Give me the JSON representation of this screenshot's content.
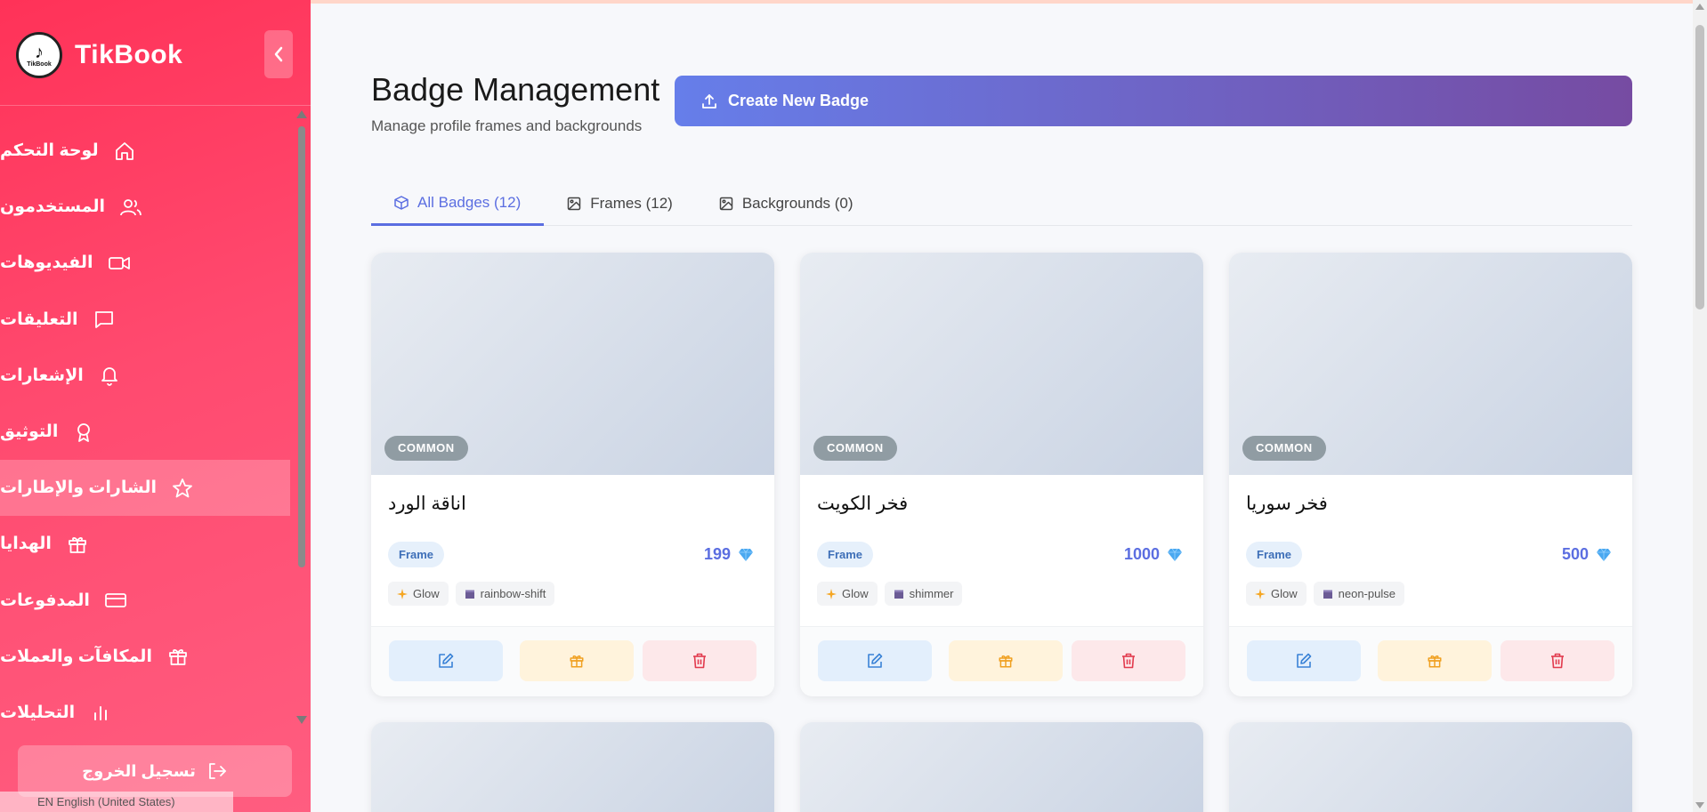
{
  "app": {
    "brand": "TikBook",
    "logo_text": "TikBook"
  },
  "sidebar": {
    "items": [
      {
        "label": "لوحة التحكم",
        "icon": "home-icon"
      },
      {
        "label": "المستخدمون",
        "icon": "users-icon"
      },
      {
        "label": "الفيديوهات",
        "icon": "video-icon"
      },
      {
        "label": "التعليقات",
        "icon": "comment-icon"
      },
      {
        "label": "الإشعارات",
        "icon": "bell-icon"
      },
      {
        "label": "التوثيق",
        "icon": "award-icon"
      },
      {
        "label": "الشارات والإطارات",
        "icon": "star-icon",
        "active": true
      },
      {
        "label": "الهدايا",
        "icon": "gift-icon"
      },
      {
        "label": "المدفوعات",
        "icon": "card-icon"
      },
      {
        "label": "المكافآت والعملات",
        "icon": "gift-icon"
      },
      {
        "label": "التحليلات",
        "icon": "chart-icon"
      }
    ],
    "logout": "تسجيل الخروج",
    "language": "EN English (United States)"
  },
  "header": {
    "title": "Badge Management",
    "subtitle": "Manage profile frames and backgrounds",
    "create_button": "Create New Badge"
  },
  "tabs": [
    {
      "label": "All Badges (12)",
      "active": true
    },
    {
      "label": "Frames (12)"
    },
    {
      "label": "Backgrounds (0)"
    }
  ],
  "cards": [
    {
      "name": "اناقة الورد",
      "rarity": "COMMON",
      "type": "Frame",
      "price": "199",
      "tags": [
        "Glow",
        "rainbow-shift"
      ]
    },
    {
      "name": "فخر الكويت",
      "rarity": "COMMON",
      "type": "Frame",
      "price": "1000",
      "tags": [
        "Glow",
        "shimmer"
      ]
    },
    {
      "name": "فخر سوريا",
      "rarity": "COMMON",
      "type": "Frame",
      "price": "500",
      "tags": [
        "Glow",
        "neon-pulse"
      ]
    }
  ],
  "colors": {
    "sidebar": "#ff3258",
    "accent": "#5b6ee1",
    "gradient_start": "#667eea",
    "gradient_end": "#764ba2"
  }
}
